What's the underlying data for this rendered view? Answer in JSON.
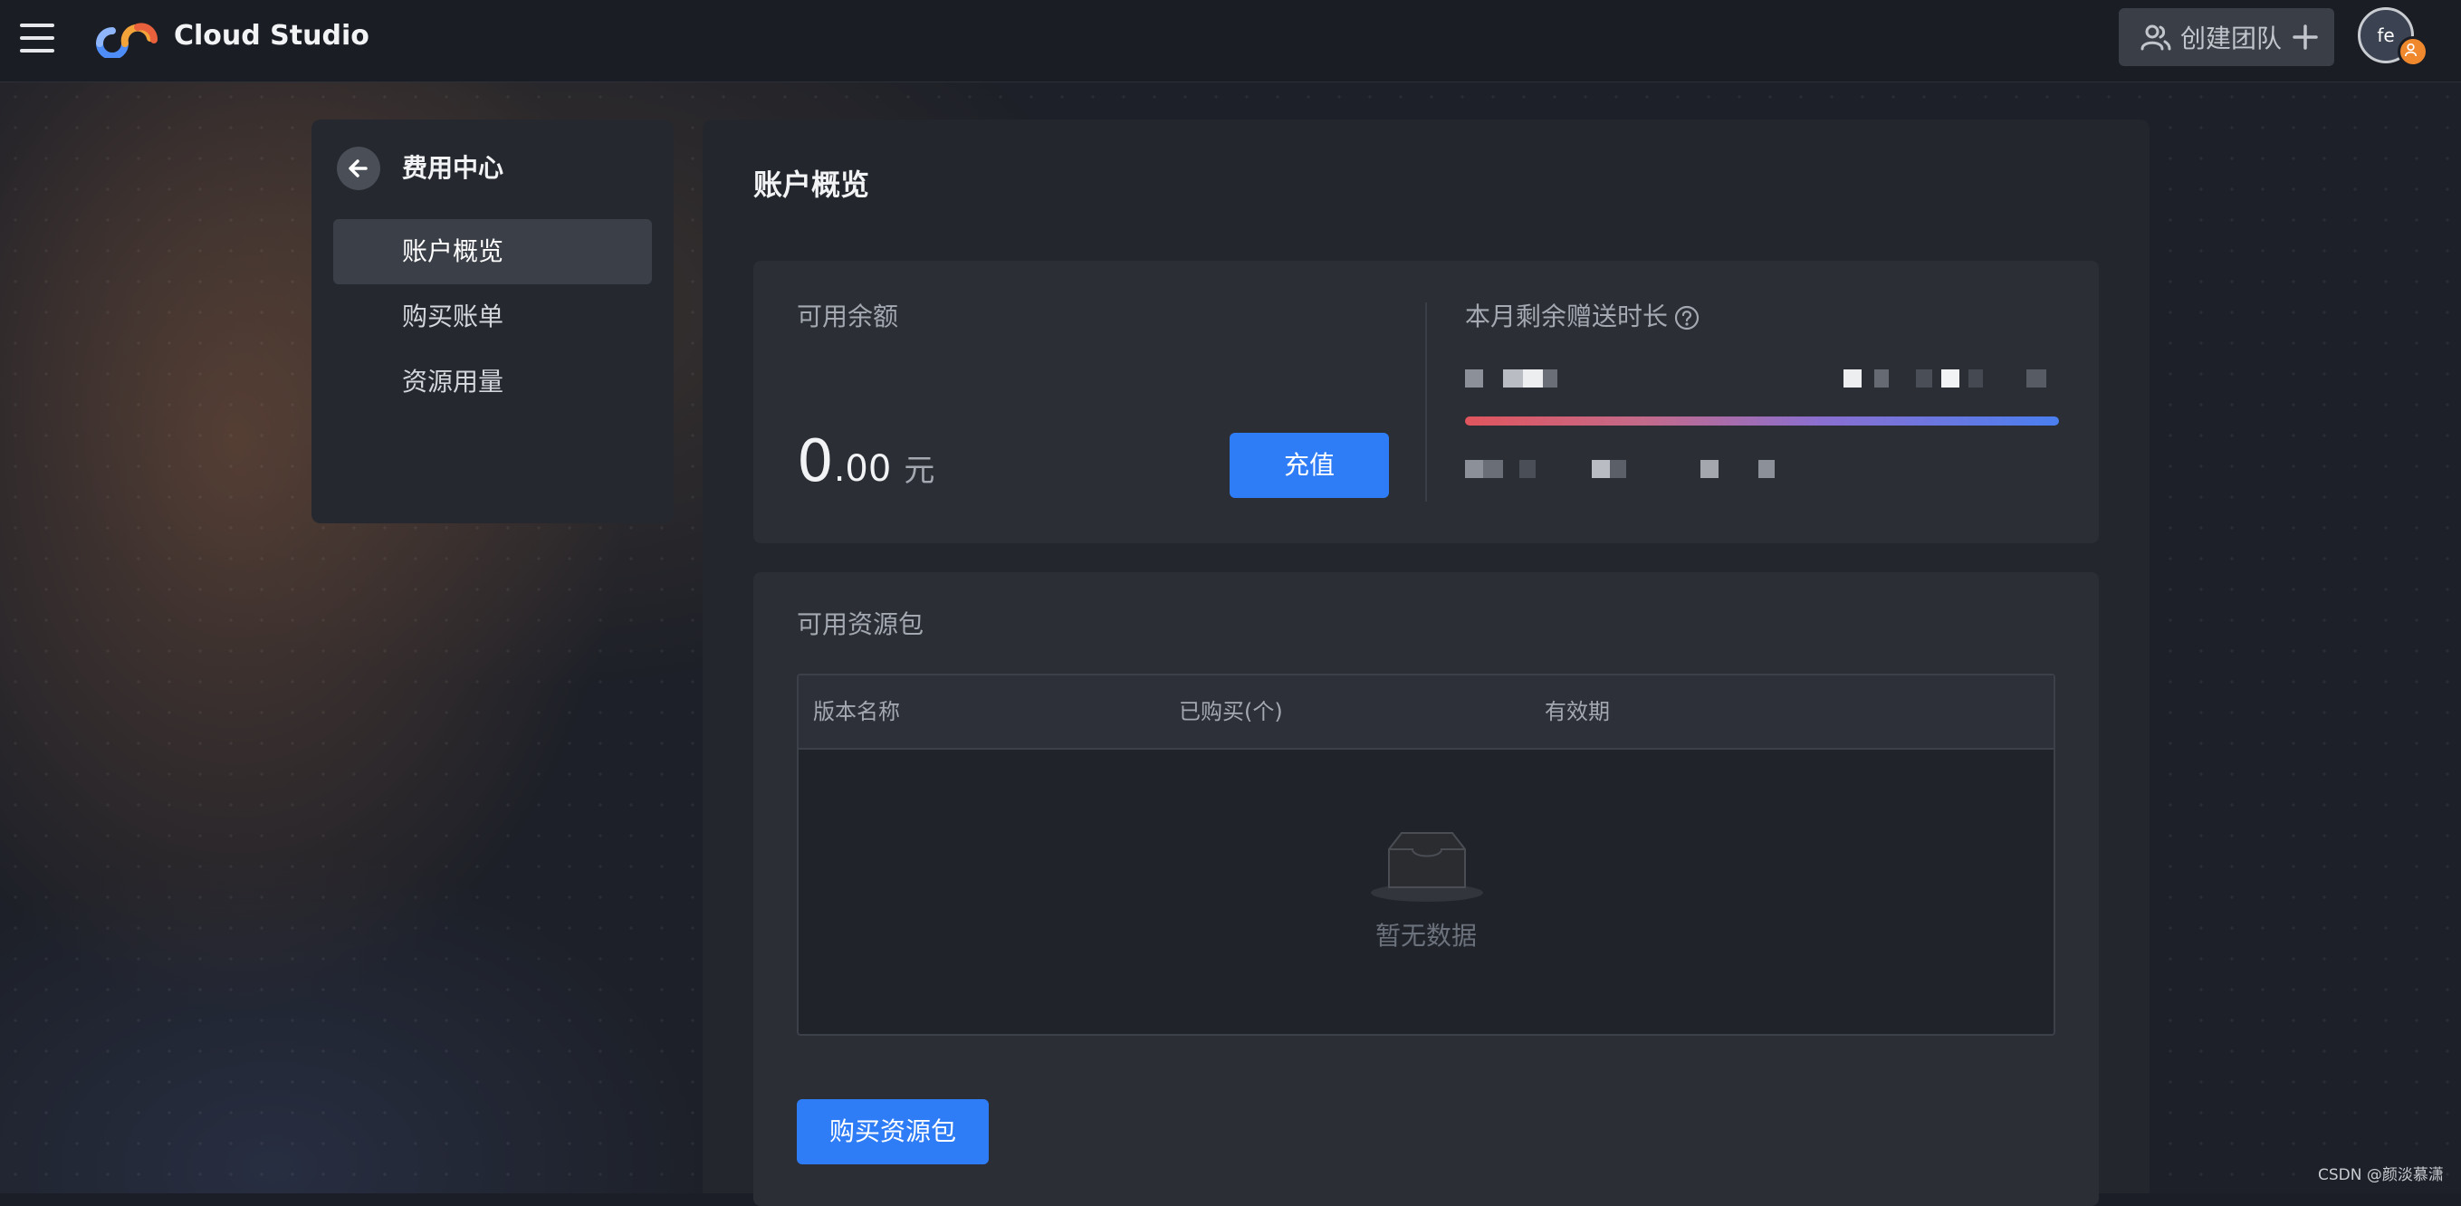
{
  "header": {
    "brand": "Cloud Studio",
    "create_team_label": "创建团队",
    "avatar_initials": "fe"
  },
  "sidebar": {
    "title": "费用中心",
    "items": [
      {
        "label": "账户概览",
        "active": true
      },
      {
        "label": "购买账单",
        "active": false
      },
      {
        "label": "资源用量",
        "active": false
      }
    ]
  },
  "main": {
    "title": "账户概览",
    "balance_card": {
      "label": "可用余额",
      "amount_int": "0",
      "amount_dec": ".00",
      "unit": "元",
      "recharge_label": "充值"
    },
    "gift_card": {
      "label": "本月剩余赠送时长"
    },
    "packages": {
      "title": "可用资源包",
      "columns": [
        "版本名称",
        "已购买(个)",
        "有效期"
      ],
      "empty_text": "暂无数据",
      "buy_label": "购买资源包"
    }
  },
  "watermark": "CSDN @颜淡慕潇",
  "colors": {
    "accent": "#2f7df6",
    "avatar_badge": "#f0882e",
    "bar_start": "#e0555d",
    "bar_end": "#4a7ff0"
  },
  "icons": [
    "menu-icon",
    "cloud-studio-logo",
    "user-group-icon",
    "plus-icon",
    "back-arrow-icon",
    "help-circle-icon",
    "empty-inbox-icon"
  ]
}
